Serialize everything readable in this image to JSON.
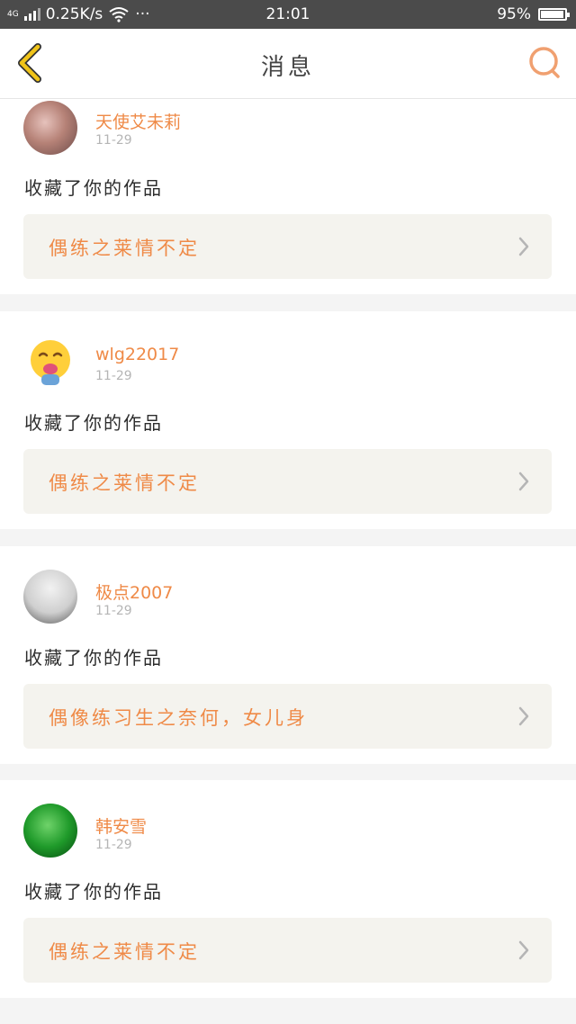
{
  "status_bar": {
    "network_type": "4G",
    "speed": "0.25K/s",
    "more": "···",
    "time": "21:01",
    "battery": "95%",
    "battery_level": 0.95
  },
  "header": {
    "title": "消息",
    "back_icon": "chevron-left-icon",
    "search_icon": "search-icon"
  },
  "colors": {
    "accent": "#ef8a47",
    "back_icon": "#f0c419",
    "card_bg": "#f4f3ee"
  },
  "messages": [
    {
      "user": "天使艾未莉",
      "date": "11-29",
      "action": "收藏了你的作品",
      "work_title": "偶练之莱情不定"
    },
    {
      "user": "wlg22017",
      "date": "11-29",
      "action": "收藏了你的作品",
      "work_title": "偶练之莱情不定"
    },
    {
      "user": "极点2007",
      "date": "11-29",
      "action": "收藏了你的作品",
      "work_title": "偶像练习生之奈何，女儿身"
    },
    {
      "user": "韩安雪",
      "date": "11-29",
      "action": "收藏了你的作品",
      "work_title": "偶练之莱情不定"
    }
  ]
}
